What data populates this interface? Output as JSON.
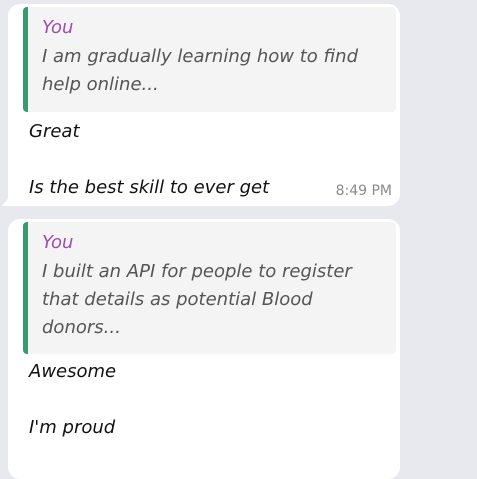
{
  "messages": [
    {
      "quote": {
        "author": "You",
        "text": "I am gradually learning how to find help online..."
      },
      "lines": [
        "Great",
        "Is the best skill to ever get"
      ],
      "time": "8:49 PM"
    },
    {
      "quote": {
        "author": "You",
        "text": "I built an API for people to register that details as potential Blood donors..."
      },
      "lines": [
        "Awesome",
        "I'm proud"
      ]
    }
  ],
  "colors": {
    "background": "#e8e9ef",
    "bubble": "#ffffff",
    "quote_bar": "#3a9a6f",
    "quote_author": "#a04db2",
    "timestamp": "#8a8a8a"
  }
}
